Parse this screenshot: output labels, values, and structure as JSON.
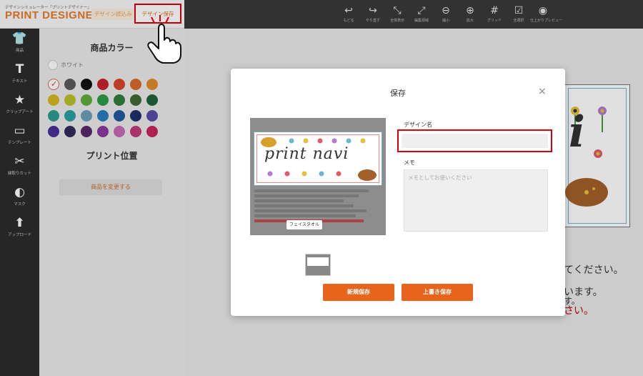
{
  "header": {
    "brand_sub": "デザインシミュレーター「プリントデザイナー」",
    "brand_title": "PRINT DESIGNER",
    "load_label": "デザイン読込み",
    "save_design_label": "デザイン保存",
    "tools": [
      {
        "icon": "undo-icon",
        "glyph": "↩",
        "label": "もどる"
      },
      {
        "icon": "redo-icon",
        "glyph": "↪",
        "label": "やり直す"
      },
      {
        "icon": "fit-all-icon",
        "glyph": "⤡",
        "label": "全体表示"
      },
      {
        "icon": "edit-area-icon",
        "glyph": "⤢",
        "label": "編集領域"
      },
      {
        "icon": "zoom-out-icon",
        "glyph": "⊖",
        "label": "縮小"
      },
      {
        "icon": "zoom-in-icon",
        "glyph": "⊕",
        "label": "拡大"
      },
      {
        "icon": "grid-icon",
        "glyph": "#",
        "label": "グリッド"
      },
      {
        "icon": "select-all-icon",
        "glyph": "☑",
        "label": "全選択"
      },
      {
        "icon": "eye-icon",
        "glyph": "◉",
        "label": "仕上がりプレビュー"
      }
    ]
  },
  "rail": [
    {
      "icon": "tshirt-icon",
      "glyph": "👕",
      "label": "商品"
    },
    {
      "icon": "text-icon",
      "glyph": "T",
      "label": "テキスト"
    },
    {
      "icon": "clipart-icon",
      "glyph": "★",
      "label": "クリップアート"
    },
    {
      "icon": "folder-icon",
      "glyph": "▭",
      "label": "テンプレート"
    },
    {
      "icon": "scissors-icon",
      "glyph": "✂",
      "label": "縁取りカット"
    },
    {
      "icon": "mask-icon",
      "glyph": "◐",
      "label": "マスク"
    },
    {
      "icon": "upload-icon",
      "glyph": "⬆",
      "label": "アップロード"
    }
  ],
  "panel": {
    "color_title": "商品カラー",
    "white_label": "ホワイト",
    "print_position_title": "プリント位置",
    "change_product_label": "商品を変更する",
    "colors": [
      "#ffffff",
      "#5a5a5a",
      "#111111",
      "#c8222e",
      "#d8452b",
      "#d96a2a",
      "#e08a2a",
      "#d9b81f",
      "#b8c22a",
      "#5dae3a",
      "#2f9b49",
      "#2f7e3d",
      "#3f6a34",
      "#1f6338",
      "#2b9e8c",
      "#2aa0a6",
      "#6a9fbe",
      "#2a7ec0",
      "#1f5aa0",
      "#1f2f6a",
      "#5b4aa8",
      "#4d2f9a",
      "#332a5a",
      "#5a2a6a",
      "#8a3a9a",
      "#c86ab8",
      "#c43a7a",
      "#c4265a"
    ]
  },
  "modal": {
    "title": "保存",
    "close_glyph": "×",
    "preview_text": "print navi",
    "preview_tag": "フェイスタオル",
    "design_name_label": "デザイン名",
    "design_name_value": "",
    "memo_label": "メモ",
    "memo_placeholder": "メモとしてお使いください",
    "new_save_label": "新規保存",
    "overwrite_save_label": "上書き保存"
  },
  "background": {
    "line1": "てください。",
    "line2": "います。",
    "line3": "す。",
    "line4": "さい。"
  }
}
